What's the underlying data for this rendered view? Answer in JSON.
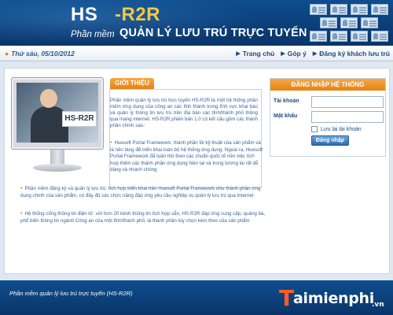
{
  "header": {
    "logo_hs": "HS",
    "logo_r2r": "-R2R",
    "slogan_small": "Phần mềm",
    "slogan_big": "QUẢN LÝ LƯU TRÚ TRỰC TUYẾN"
  },
  "navbar": {
    "date": "Thứ sáu, 05/10/2012",
    "links": [
      "Trang chủ",
      "Góp ý",
      "Đăng ký khách lưu trú"
    ]
  },
  "intro": {
    "tab_label": "GIỚI THIỆU",
    "screen_label": "HS-R2R",
    "text": "Phần mềm quản lý lưu trú trực tuyến HS-R2R là một hệ thống phần mềm ứng dụng của công an các tỉnh thành trong lĩnh vực khai báo và quản lý thông tin lưu trú trên địa bàn các tỉnh/thành phố thông qua mạng internet. HS-R2R phiên bản 1.0 có kết cấu gồm các thành phần chính sau:",
    "bullets": [
      "Huesoft Portal Framework: thành phần lõi kỹ thuật của sản phẩm và là nền tảng để triển khai toàn bộ hệ thống ứng dụng. Ngoài ra, Huesoft Portal Framework đã tuân thủ theo các chuẩn quốc tế nên việc tích hợp thêm các thành phần ứng dụng hiện tại và trong tương lai rất dễ dàng và nhanh chóng",
      "Phần mềm đăng ký và quản lý lưu trú: tích hợp triển khai trên Huesoft Portal Framework như thành phần ứng dụng chính của sản phẩm, có đầy đủ các chức năng đáp ứng yêu cầu nghiệp vụ quản lý lưu trú qua Internet",
      "Hệ thống cổng thông tin điện tử: với hơn 20 kênh thông tin tích hợp sẵn, HS-R2R đáp ứng cung cấp, quảng bá, phổ biến thông tin ngành Công an của một tỉnh/thành phố, là thành phần tùy chọn kèm theo của sản phẩm"
    ]
  },
  "login": {
    "title": "ĐĂNG NHẬP HỆ THỐNG",
    "username_label": "Tài khoản",
    "username_value": "",
    "password_label": "Mật khẩu",
    "password_value": "",
    "remember_label": "Lưu lại tài khoản",
    "remember_checked": false,
    "submit_label": "Đăng nhập"
  },
  "footer": {
    "text": "Phần mềm quản lý lưu trú trực tuyến (HS-R2R)",
    "watermark_t": "T",
    "watermark_rest": "aimienphi",
    "watermark_vn": ".vn"
  }
}
